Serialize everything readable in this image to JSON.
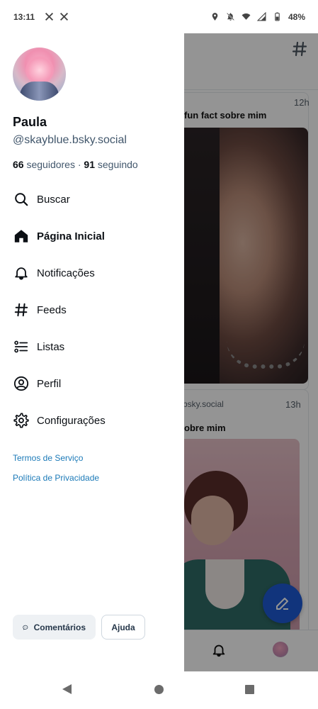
{
  "status_bar": {
    "time": "13:11",
    "battery": "48%",
    "icons": [
      "x-icon",
      "x-icon",
      "location-icon",
      "mute-icon",
      "wifi-icon",
      "signal-icon",
      "battery-icon"
    ]
  },
  "drawer": {
    "user": {
      "display_name": "Paula",
      "handle": "@skayblue.bsky.social",
      "followers_count": "66",
      "followers_label": "seguidores",
      "separator": "·",
      "following_count": "91",
      "following_label": "seguindo"
    },
    "menu": [
      {
        "label": "Buscar",
        "icon": "search-icon",
        "active": false
      },
      {
        "label": "Página Inicial",
        "icon": "home-icon",
        "active": true
      },
      {
        "label": "Notificações",
        "icon": "bell-icon",
        "active": false
      },
      {
        "label": "Feeds",
        "icon": "hash-icon",
        "active": false
      },
      {
        "label": "Listas",
        "icon": "list-icon",
        "active": false
      },
      {
        "label": "Perfil",
        "icon": "profile-icon",
        "active": false
      },
      {
        "label": "Configurações",
        "icon": "gear-icon",
        "active": false
      }
    ],
    "links": {
      "terms": "Termos de Serviço",
      "privacy": "Política de Privacidade"
    },
    "buttons": {
      "feedback": "Comentários",
      "help": "Ajuda"
    }
  },
  "feed": {
    "posts": [
      {
        "time": "12h",
        "text": "fun fact sobre mim"
      },
      {
        "handle": "bsky.social",
        "time": "13h",
        "text": "obre mim"
      }
    ]
  },
  "colors": {
    "accent": "#1e5bd6",
    "link": "#1c7ab8",
    "text_primary": "#0b0f14",
    "text_secondary": "#42576c"
  }
}
